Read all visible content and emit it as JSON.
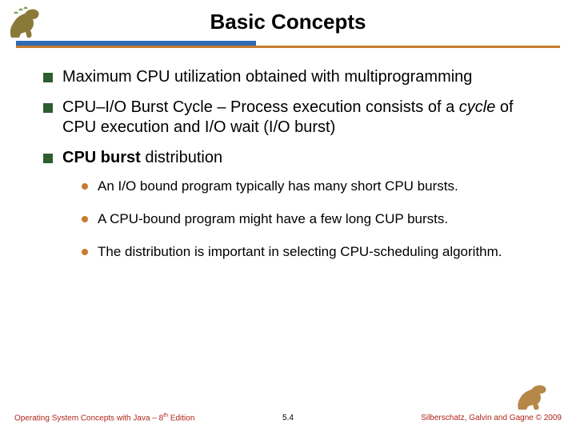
{
  "title": "Basic Concepts",
  "bullets": {
    "b1": "Maximum CPU utilization obtained with multiprogramming",
    "b2_pre": "CPU–I/O Burst Cycle – Process execution consists of a ",
    "b2_it": "cycle",
    "b2_post": " of CPU execution and I/O wait (I/O burst)",
    "b3_bold": "CPU burst",
    "b3_post": " distribution",
    "s1": "An I/O bound program typically has many short CPU bursts.",
    "s2": "A CPU-bound program might have a few long CUP bursts.",
    "s3": "The distribution is important in selecting CPU-scheduling algorithm."
  },
  "footer": {
    "left_a": "Operating System Concepts  with Java – 8",
    "left_b": " Edition",
    "th": "th",
    "center": "5.4",
    "right": "Silberschatz, Galvin and Gagne © 2009"
  }
}
